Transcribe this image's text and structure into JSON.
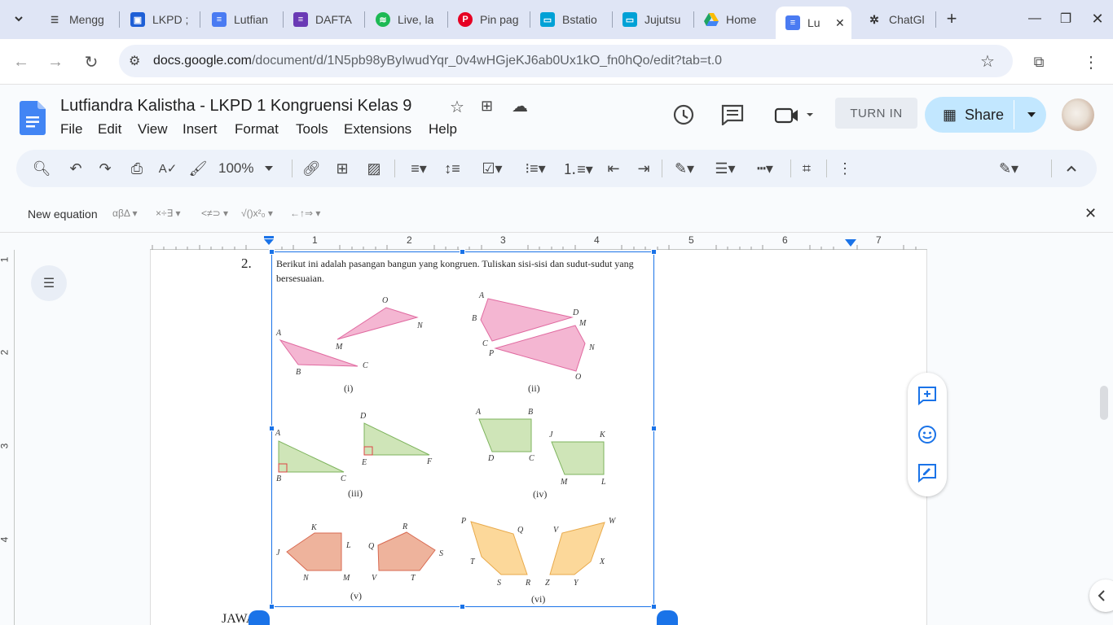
{
  "tabs": [
    {
      "title": "Mengg",
      "icon": "list-icon"
    },
    {
      "title": "LKPD ;",
      "icon": "classroom-icon"
    },
    {
      "title": "Lutfian",
      "icon": "docs-icon"
    },
    {
      "title": "DAFTA",
      "icon": "forms-icon"
    },
    {
      "title": "Live, la",
      "icon": "spotify-icon"
    },
    {
      "title": "Pin pag",
      "icon": "pinterest-icon"
    },
    {
      "title": "Bstatio",
      "icon": "bilibili-icon"
    },
    {
      "title": "Jujutsu",
      "icon": "bilibili-icon"
    },
    {
      "title": "Home",
      "icon": "drive-icon"
    },
    {
      "title": "Lu",
      "icon": "docs-icon",
      "active": true
    },
    {
      "title": "ChatGl",
      "icon": "chatgpt-icon"
    }
  ],
  "address": {
    "host": "docs.google.com",
    "path": "/document/d/1N5pb98yByIwudYqr_0v4wHGjeKJ6ab0Ux1kO_fn0hQo/edit?tab=t.0"
  },
  "doc": {
    "title": "Lutfiandra Kalistha - LKPD 1 Kongruensi Kelas 9",
    "menus": [
      "File",
      "Edit",
      "View",
      "Insert",
      "Format",
      "Tools",
      "Extensions",
      "Help"
    ],
    "turn_in": "TURN IN",
    "share": "Share"
  },
  "toolbar": {
    "zoom": "100%"
  },
  "equation": {
    "new_equation": "New equation",
    "groups": [
      "αβΔ",
      "×÷∃",
      "<≠⊃",
      "√()x²₀",
      "←↑⇒"
    ]
  },
  "ruler": {
    "numbers": [
      "1",
      "2",
      "3",
      "4",
      "5",
      "6",
      "7"
    ],
    "vnumbers": [
      "1",
      "2",
      "3",
      "4"
    ]
  },
  "content": {
    "item_number": "2.",
    "question": "Berikut ini adalah pasangan bangun yang kongruen. Tuliskan sisi-sisi dan sudut-sudut yang bersesuaian.",
    "captions": [
      "(i)",
      "(ii)",
      "(iii)",
      "(iv)",
      "(v)",
      "(vi)"
    ],
    "below_text": "JAWAB"
  },
  "colors": {
    "pink": "#f4b6d2",
    "pink_stroke": "#e06aa0",
    "green": "#cfe5b8",
    "green_stroke": "#7db35c",
    "salmon": "#eeb39c",
    "salmon_stroke": "#d86a52",
    "yellow": "#fcd89a",
    "yellow_stroke": "#e8a94a",
    "accent": "#1a73e8",
    "share_bg": "#c2e7ff"
  }
}
